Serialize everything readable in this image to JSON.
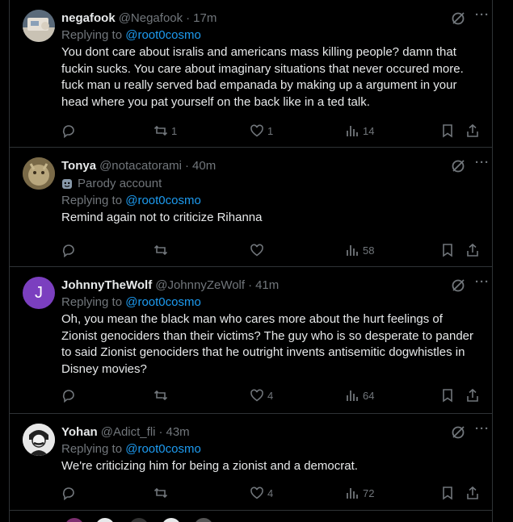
{
  "posts": [
    {
      "name": "negafook",
      "handle": "@Negafook",
      "time": "17m",
      "replying_label": "Replying to ",
      "replying_to": "@root0cosmo",
      "text": "You dont care about isralis and americans mass killing people? damn that fuckin sucks. You care about imaginary situations that never occured more. fuck man u really served bad empanada by making up a argument in your head where you pat yourself on the back like in a ted talk.",
      "retweets": "1",
      "likes": "1",
      "views": "14"
    },
    {
      "name": "Tonya",
      "handle": "@notacatorami",
      "time": "40m",
      "parody_label": "Parody account",
      "replying_label": "Replying to ",
      "replying_to": "@root0cosmo",
      "text": "Remind again not to criticize Rihanna",
      "retweets": "",
      "likes": "",
      "views": "58"
    },
    {
      "name": "JohnnyTheWolf",
      "handle": "@JohnnyZeWolf",
      "time": "41m",
      "avatar_letter": "J",
      "replying_label": "Replying to ",
      "replying_to": "@root0cosmo",
      "text": "Oh, you mean the black man who cares more about the hurt feelings of Zionist genociders than their victims? The guy who is so desperate to pander to said Zionist genociders that he outright invents antisemitic dogwhistles in Disney movies?",
      "retweets": "",
      "likes": "4",
      "views": "64"
    },
    {
      "name": "Yohan",
      "handle": "@Adict_fli",
      "time": "43m",
      "replying_label": "Replying to ",
      "replying_to": "@root0cosmo",
      "text": "We're criticizing him for being a zionist and a democrat.",
      "retweets": "",
      "likes": "4",
      "views": "72"
    }
  ],
  "colors": {
    "background": "#000000",
    "text": "#e7e9ea",
    "muted": "#71767b",
    "link": "#1d9bf0",
    "border": "#2f3336",
    "avatar_j": "#7b3fbf"
  },
  "icons": [
    "reply-icon",
    "repost-icon",
    "like-icon",
    "views-icon",
    "bookmark-icon",
    "share-icon",
    "grok-icon",
    "more-icon",
    "parody-mask-icon"
  ],
  "dot": "·",
  "more_glyph": "···"
}
